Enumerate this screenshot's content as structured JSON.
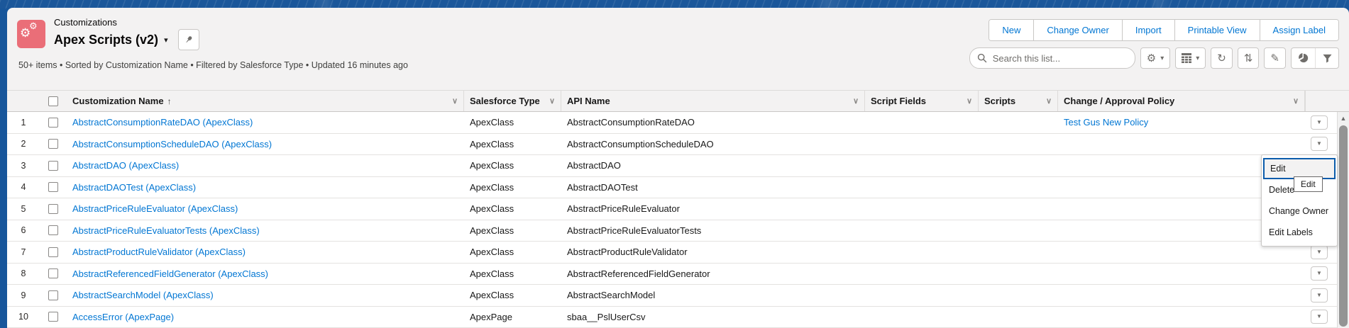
{
  "header": {
    "object_label": "Customizations",
    "title": "Apex Scripts (v2)",
    "status_line": "50+ items • Sorted by Customization Name • Filtered by Salesforce Type • Updated 16 minutes ago",
    "action_buttons": [
      "New",
      "Change Owner",
      "Import",
      "Printable View",
      "Assign Label"
    ]
  },
  "search": {
    "placeholder": "Search this list..."
  },
  "toolbar_icons": [
    "list-view-controls-gear",
    "display-as-grid",
    "refresh",
    "sort",
    "inline-edit-pencil",
    "charts-pie",
    "filter-funnel"
  ],
  "icons": {
    "app_icon": "gears-customizations",
    "title_caret": "▾",
    "pin": "pushpin",
    "header_chevron": "∨",
    "sort_asc_arrow": "↑",
    "row_action_caret": "▼",
    "scroll_up_arrow": "▲",
    "gear": "⚙",
    "grid": "▦",
    "refresh": "↻",
    "sort": "⇅",
    "pencil": "✎"
  },
  "table": {
    "columns": [
      {
        "key": "name",
        "label": "Customization Name",
        "sorted": "asc"
      },
      {
        "key": "type",
        "label": "Salesforce Type"
      },
      {
        "key": "api",
        "label": "API Name"
      },
      {
        "key": "sf",
        "label": "Script Fields"
      },
      {
        "key": "scripts",
        "label": "Scripts"
      },
      {
        "key": "policy",
        "label": "Change / Approval Policy"
      }
    ],
    "rows": [
      {
        "num": "1",
        "name": "AbstractConsumptionRateDAO (ApexClass)",
        "type": "ApexClass",
        "api": "AbstractConsumptionRateDAO",
        "sf": "",
        "scripts": "",
        "policy": "Test Gus New Policy"
      },
      {
        "num": "2",
        "name": "AbstractConsumptionScheduleDAO (ApexClass)",
        "type": "ApexClass",
        "api": "AbstractConsumptionScheduleDAO",
        "sf": "",
        "scripts": "",
        "policy": ""
      },
      {
        "num": "3",
        "name": "AbstractDAO (ApexClass)",
        "type": "ApexClass",
        "api": "AbstractDAO",
        "sf": "",
        "scripts": "",
        "policy": ""
      },
      {
        "num": "4",
        "name": "AbstractDAOTest (ApexClass)",
        "type": "ApexClass",
        "api": "AbstractDAOTest",
        "sf": "",
        "scripts": "",
        "policy": ""
      },
      {
        "num": "5",
        "name": "AbstractPriceRuleEvaluator (ApexClass)",
        "type": "ApexClass",
        "api": "AbstractPriceRuleEvaluator",
        "sf": "",
        "scripts": "",
        "policy": ""
      },
      {
        "num": "6",
        "name": "AbstractPriceRuleEvaluatorTests (ApexClass)",
        "type": "ApexClass",
        "api": "AbstractPriceRuleEvaluatorTests",
        "sf": "",
        "scripts": "",
        "policy": ""
      },
      {
        "num": "7",
        "name": "AbstractProductRuleValidator (ApexClass)",
        "type": "ApexClass",
        "api": "AbstractProductRuleValidator",
        "sf": "",
        "scripts": "",
        "policy": ""
      },
      {
        "num": "8",
        "name": "AbstractReferencedFieldGenerator (ApexClass)",
        "type": "ApexClass",
        "api": "AbstractReferencedFieldGenerator",
        "sf": "",
        "scripts": "",
        "policy": ""
      },
      {
        "num": "9",
        "name": "AbstractSearchModel (ApexClass)",
        "type": "ApexClass",
        "api": "AbstractSearchModel",
        "sf": "",
        "scripts": "",
        "policy": ""
      },
      {
        "num": "10",
        "name": "AccessError (ApexPage)",
        "type": "ApexPage",
        "api": "sbaa__PslUserCsv",
        "sf": "",
        "scripts": "",
        "policy": ""
      }
    ]
  },
  "row_menu": {
    "items": [
      "Edit",
      "Delete",
      "Change Owner",
      "Edit Labels"
    ],
    "focused_item": "Edit",
    "tooltip": "Edit"
  },
  "colors": {
    "brand_bar": "#1b579a",
    "app_icon": "#ea6e78",
    "link": "#0176d3",
    "focus_outline": "#0b5cab",
    "page_header_bg": "#f3f2f2"
  }
}
